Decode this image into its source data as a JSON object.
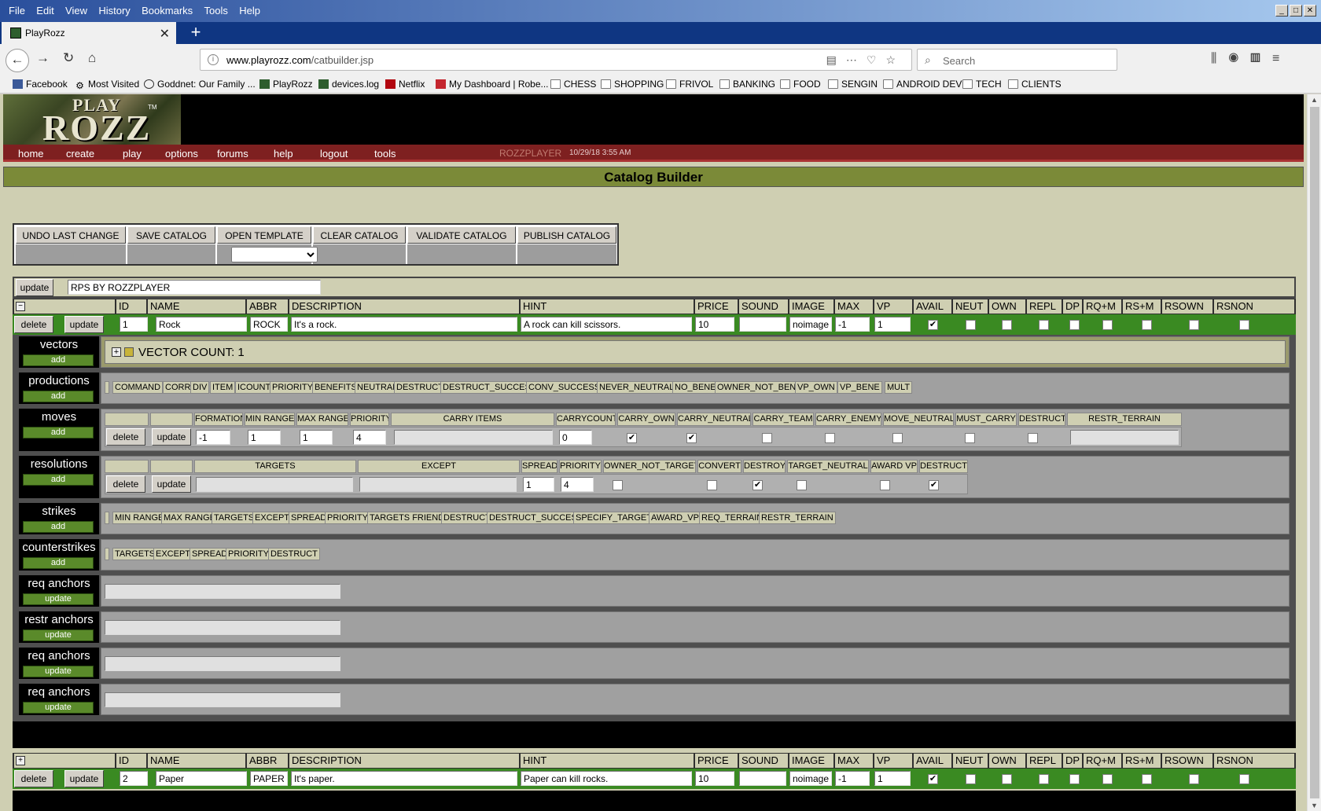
{
  "browser": {
    "menu": [
      "File",
      "Edit",
      "View",
      "History",
      "Bookmarks",
      "Tools",
      "Help"
    ],
    "tab_title": "PlayRozz",
    "url_domain": "www.playrozz.com",
    "url_path": "/catbuilder.jsp",
    "search_placeholder": "Search",
    "bookmarks": [
      "Facebook",
      "Most Visited",
      "Goddnet: Our Family ...",
      "PlayRozz",
      "devices.log",
      "Netflix",
      "My Dashboard | Robe...",
      "CHESS",
      "SHOPPING",
      "FRIVOL",
      "BANKING",
      "FOOD",
      "SENGIN",
      "ANDROID DEV",
      "TECH",
      "CLIENTS"
    ]
  },
  "site": {
    "logo_top": "PLAY",
    "logo_main": "ROZZ",
    "logo_tm": "TM",
    "nav": [
      "home",
      "create",
      "play",
      "options",
      "forums",
      "help",
      "logout",
      "tools"
    ],
    "user": "ROZZPLAYER",
    "time": "10/29/18 3:55 AM",
    "page_title": "Catalog Builder"
  },
  "toolbar": {
    "buttons": [
      "UNDO LAST CHANGE",
      "SAVE CATALOG",
      "OPEN TEMPLATE",
      "CLEAR CATALOG",
      "VALIDATE CATALOG",
      "PUBLISH CATALOG"
    ]
  },
  "catalog": {
    "update_label": "update",
    "name": "RPS BY ROZZPLAYER"
  },
  "columns": [
    "ID",
    "NAME",
    "ABBR",
    "DESCRIPTION",
    "HINT",
    "PRICE",
    "SOUND",
    "IMAGE",
    "MAX",
    "VP",
    "AVAIL",
    "NEUT",
    "OWN",
    "REPL",
    "DP",
    "RQ+M",
    "RS+M",
    "RSOWN",
    "RSNON"
  ],
  "items": [
    {
      "toggle": "−",
      "delete": "delete",
      "update": "update",
      "id": "1",
      "name": "Rock",
      "abbr": "ROCK",
      "description": "It's a rock.",
      "hint": "A rock can kill scissors.",
      "price": "10",
      "sound": "",
      "image": "noimage",
      "max": "-1",
      "vp": "1",
      "avail": "✔"
    },
    {
      "toggle": "+",
      "delete": "delete",
      "update": "update",
      "id": "2",
      "name": "Paper",
      "abbr": "PAPER",
      "description": "It's paper.",
      "hint": "Paper can kill rocks.",
      "price": "10",
      "sound": "",
      "image": "noimage",
      "max": "-1",
      "vp": "1",
      "avail": "✔"
    }
  ],
  "sections": {
    "vectors": {
      "label": "vectors",
      "btn": "add",
      "count_text": "VECTOR COUNT: 1"
    },
    "productions": {
      "label": "productions",
      "btn": "add",
      "chips": [
        "COMMAND",
        "CORR",
        "DIV",
        "ITEM",
        "ICOUNT",
        "PRIORITY",
        "BENEFITS",
        "NEUTRAL",
        "DESTRUCT",
        "DESTRUCT_SUCCESS",
        "CONV_SUCCESS",
        "NEVER_NEUTRAL",
        "NO_BENE",
        "OWNER_NOT_BENE",
        "VP_OWN",
        "VP_BENE",
        "MULT"
      ]
    },
    "moves": {
      "label": "moves",
      "btn": "add",
      "headers": [
        "FORMATION",
        "MIN RANGE",
        "MAX RANGE",
        "PRIORITY",
        "CARRY ITEMS",
        "CARRYCOUNT",
        "CARRY_OWN",
        "CARRY_NEUTRAL",
        "CARRY_TEAM",
        "CARRY_ENEMY",
        "MOVE_NEUTRAL",
        "MUST_CARRY",
        "DESTRUCT",
        "RESTR_TERRAIN"
      ],
      "values": {
        "formation": "-1",
        "min": "1",
        "max": "1",
        "priority": "4",
        "carrycount": "0"
      },
      "delete": "delete",
      "update": "update"
    },
    "resolutions": {
      "label": "resolutions",
      "btn": "add",
      "headers": [
        "TARGETS",
        "EXCEPT",
        "SPREAD",
        "PRIORITY",
        "OWNER_NOT_TARGET",
        "CONVERT",
        "DESTROY",
        "TARGET_NEUTRAL",
        "AWARD VP",
        "DESTRUCT"
      ],
      "values": {
        "spread": "1",
        "priority": "4"
      },
      "delete": "delete",
      "update": "update"
    },
    "strikes": {
      "label": "strikes",
      "btn": "add",
      "chips": [
        "MIN RANGE",
        "MAX RANGE",
        "TARGETS",
        "EXCEPT",
        "SPREAD",
        "PRIORITY",
        "TARGETS FRIEND",
        "DESTRUCT",
        "DESTRUCT_SUCCESS",
        "SPECIFY_TARGET",
        "AWARD_VP",
        "REQ_TERRAIN",
        "RESTR_TERRAIN"
      ]
    },
    "counterstrikes": {
      "label": "counterstrikes",
      "btn": "add",
      "chips": [
        "TARGETS",
        "EXCEPT",
        "SPREAD",
        "PRIORITY",
        "DESTRUCT"
      ]
    },
    "anchors": [
      {
        "label": "req anchors",
        "btn": "update"
      },
      {
        "label": "restr anchors",
        "btn": "update"
      },
      {
        "label": "req anchors",
        "btn": "update"
      },
      {
        "label": "req anchors",
        "btn": "update"
      }
    ]
  },
  "colors": {
    "green_row": "#3a8a22",
    "khaki": "#cfcfb2",
    "nav_red": "#7e2020",
    "title_olive": "#7b8a38"
  }
}
